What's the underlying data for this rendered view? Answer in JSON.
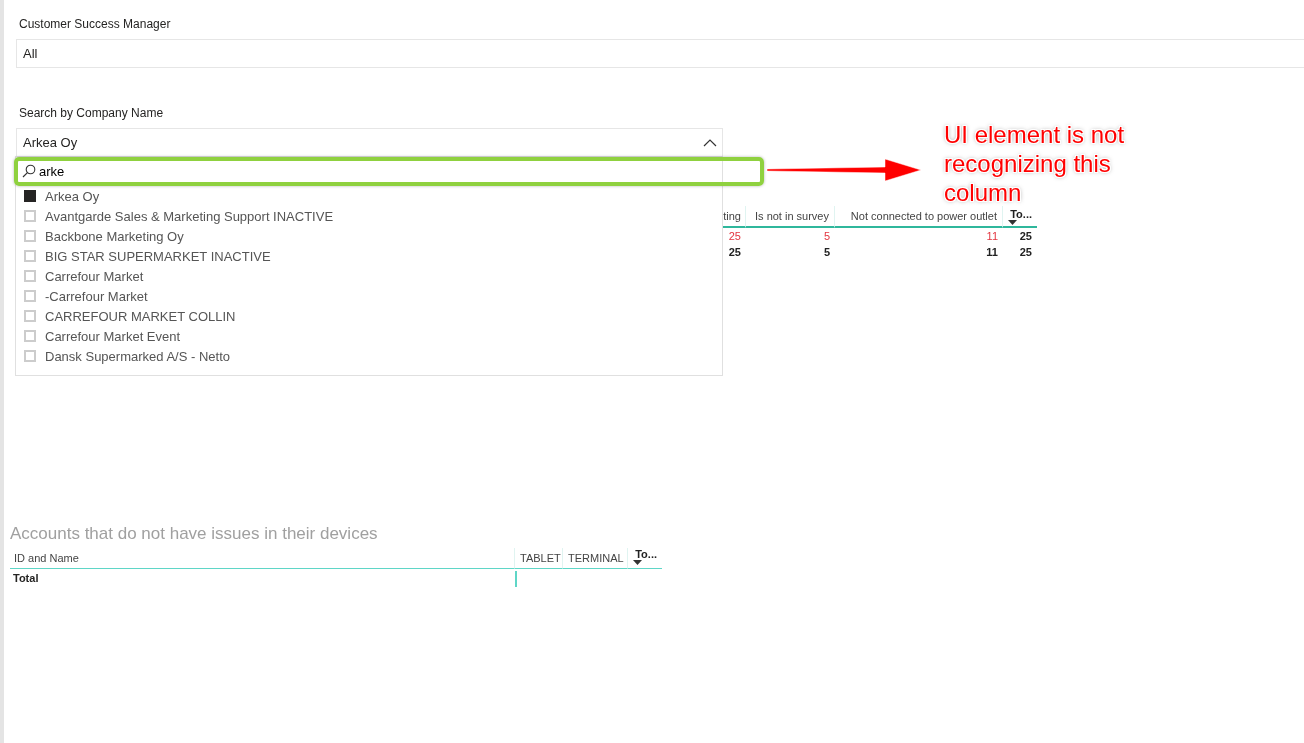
{
  "filters": [
    {
      "label": "Customer Success Manager",
      "value": "All"
    },
    {
      "label": "Search by Company Name",
      "value": "Arkea Oy",
      "expanded": true
    }
  ],
  "search": {
    "value": "arke"
  },
  "options": [
    {
      "label": "Arkea Oy",
      "selected": true
    },
    {
      "label": "Avantgarde Sales & Marketing Support INACTIVE",
      "selected": false
    },
    {
      "label": "Backbone Marketing Oy",
      "selected": false
    },
    {
      "label": "BIG STAR SUPERMARKET INACTIVE",
      "selected": false
    },
    {
      "label": "Carrefour Market",
      "selected": false
    },
    {
      "label": "-Carrefour Market",
      "selected": false
    },
    {
      "label": "CARREFOUR MARKET COLLIN",
      "selected": false
    },
    {
      "label": "Carrefour Market Event",
      "selected": false
    },
    {
      "label": "Dansk Supermarked A/S - Netto",
      "selected": false
    }
  ],
  "issues_table": {
    "columns": [
      {
        "label": "ting",
        "kind": "measure"
      },
      {
        "label": "Is not in survey",
        "kind": "measure"
      },
      {
        "label": "Not connected to power outlet",
        "kind": "measure"
      },
      {
        "label": "To...",
        "kind": "total"
      }
    ],
    "rows": [
      {
        "kind": "data",
        "cells": [
          "25",
          "5",
          "11",
          "25"
        ]
      },
      {
        "kind": "total",
        "cells": [
          "25",
          "5",
          "11",
          "25"
        ]
      }
    ]
  },
  "no_issues_table": {
    "title": "Accounts that do not have issues in their devices",
    "columns": [
      {
        "label": "ID and Name",
        "kind": "name"
      },
      {
        "label": "TABLET",
        "kind": "measure"
      },
      {
        "label": "TERMINAL",
        "kind": "measure"
      },
      {
        "label": "To...",
        "kind": "total"
      }
    ],
    "total_label": "Total"
  },
  "annotation": {
    "text": "UI element is not recognizing this column"
  }
}
